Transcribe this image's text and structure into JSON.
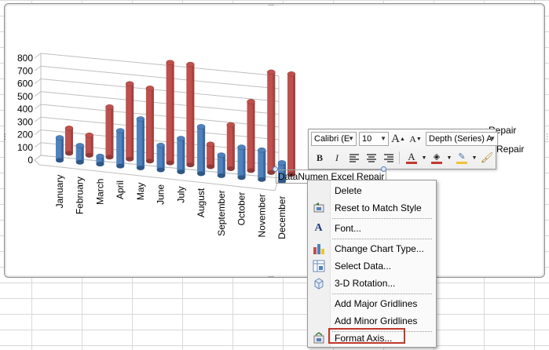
{
  "legend": {
    "entries": [
      "Repair",
      "Repair"
    ]
  },
  "chart_data": {
    "type": "bar",
    "categories": [
      "January",
      "February",
      "March",
      "April",
      "May",
      "June",
      "July",
      "August",
      "September",
      "October",
      "November",
      "December"
    ],
    "series": [
      {
        "values": [
          230,
          170,
          80,
          360,
          500,
          250,
          340,
          480,
          210,
          310,
          300,
          190
        ]
      },
      {
        "values": [
          200,
          160,
          400,
          600,
          580,
          800,
          800,
          180,
          350,
          550,
          800,
          800
        ]
      }
    ],
    "ylim": [
      0,
      800
    ],
    "yticks": [
      "800",
      "700",
      "600",
      "500",
      "400",
      "300",
      "200",
      "100",
      "0"
    ],
    "series_colors": [
      "#4f81bd",
      "#c0504d"
    ],
    "grid": true
  },
  "mini_toolbar": {
    "font_name": "Calibri (E",
    "font_size": "10",
    "grow_font": "A",
    "shrink_font": "A",
    "element_selector": "Depth (Series) A",
    "bold": "B",
    "italic": "I"
  },
  "selected_label": "DataNumen Excel Repair",
  "context_menu": {
    "items": [
      {
        "label": "Delete",
        "icon": ""
      },
      {
        "label": "Reset to Match Style",
        "icon": "reset-style-icon"
      },
      {
        "label": "Font...",
        "icon": "font-icon"
      },
      {
        "label": "Change Chart Type...",
        "icon": "chart-type-icon"
      },
      {
        "label": "Select Data...",
        "icon": "select-data-icon"
      },
      {
        "label": "3-D Rotation...",
        "icon": "rotation-icon"
      },
      {
        "label": "Add Major Gridlines",
        "icon": ""
      },
      {
        "label": "Add Minor Gridlines",
        "icon": ""
      },
      {
        "label": "Format Axis...",
        "icon": "format-axis-icon"
      }
    ]
  },
  "colors": {
    "highlight": "#c0392b",
    "accent_blue": "#4f81bd",
    "accent_red": "#c0504d"
  }
}
